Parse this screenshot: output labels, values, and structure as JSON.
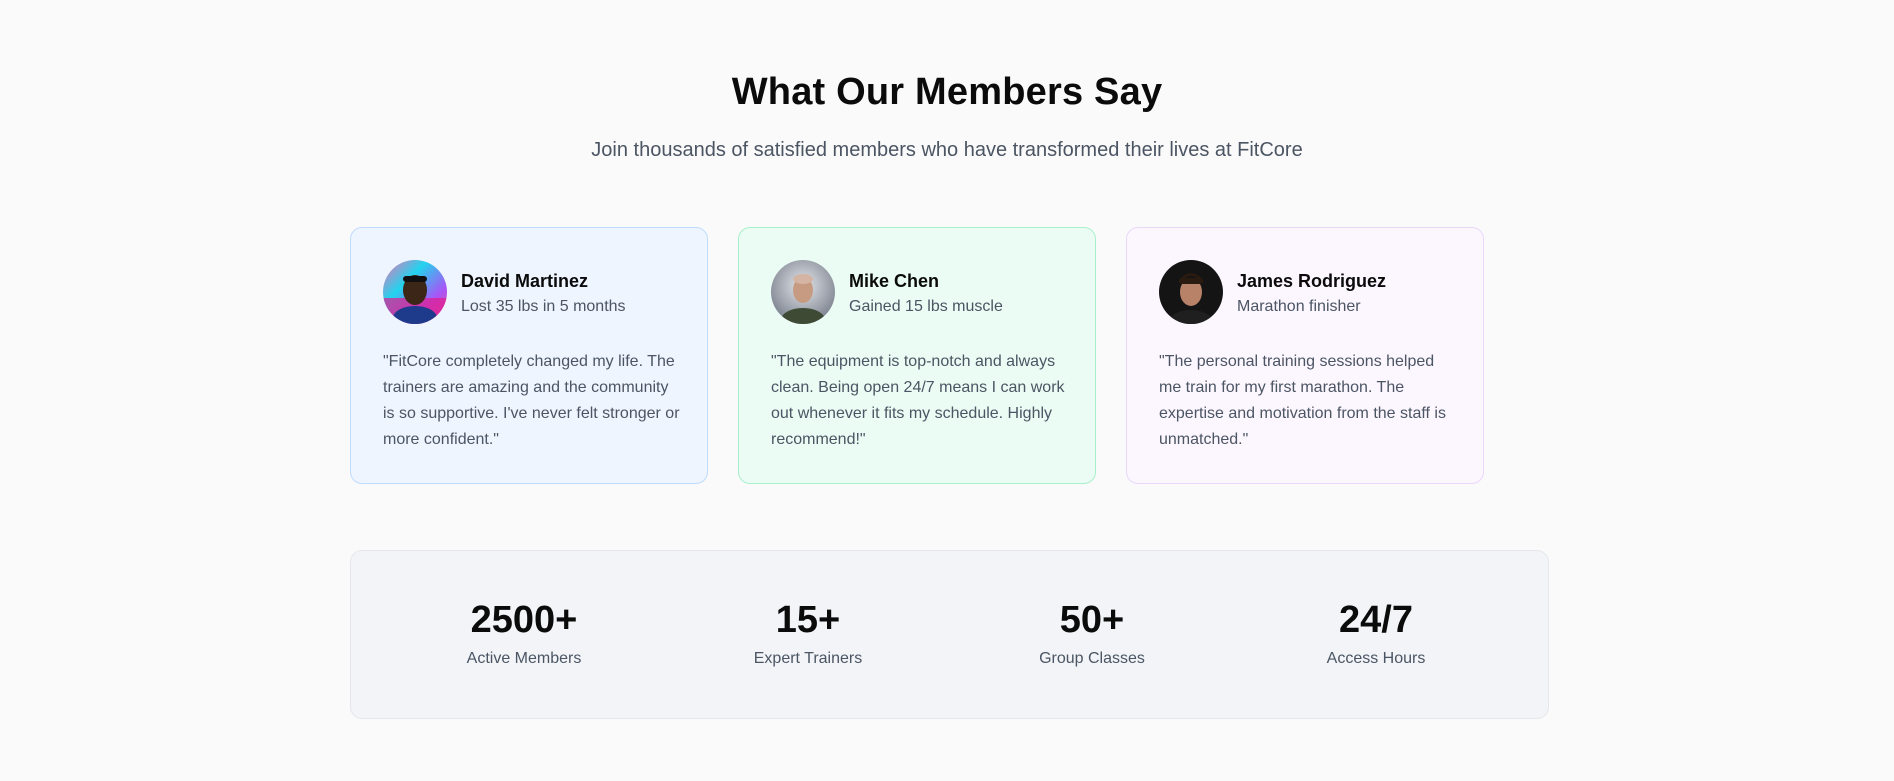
{
  "header": {
    "title": "What Our Members Say",
    "subtitle": "Join thousands of satisfied members who have transformed their lives at FitCore"
  },
  "testimonials": [
    {
      "name": "David Martinez",
      "result": "Lost 35 lbs in 5 months",
      "quote": "\"FitCore completely changed my life. The trainers are amazing and the community is so supportive. I've never felt stronger or more confident.\"",
      "card_color": "#eef5ff",
      "border_color": "#bfdbfe"
    },
    {
      "name": "Mike Chen",
      "result": "Gained 15 lbs muscle",
      "quote": "\"The equipment is top-notch and always clean. Being open 24/7 means I can work out whenever it fits my schedule. Highly recommend!\"",
      "card_color": "#ebfcf4",
      "border_color": "#a7f0cc"
    },
    {
      "name": "James Rodriguez",
      "result": "Marathon finisher",
      "quote": "\"The personal training sessions helped me train for my first marathon. The expertise and motivation from the staff is unmatched.\"",
      "card_color": "#fcf6ff",
      "border_color": "#ead8fb"
    }
  ],
  "stats": [
    {
      "value": "2500+",
      "label": "Active Members"
    },
    {
      "value": "15+",
      "label": "Expert Trainers"
    },
    {
      "value": "50+",
      "label": "Group Classes"
    },
    {
      "value": "24/7",
      "label": "Access Hours"
    }
  ]
}
